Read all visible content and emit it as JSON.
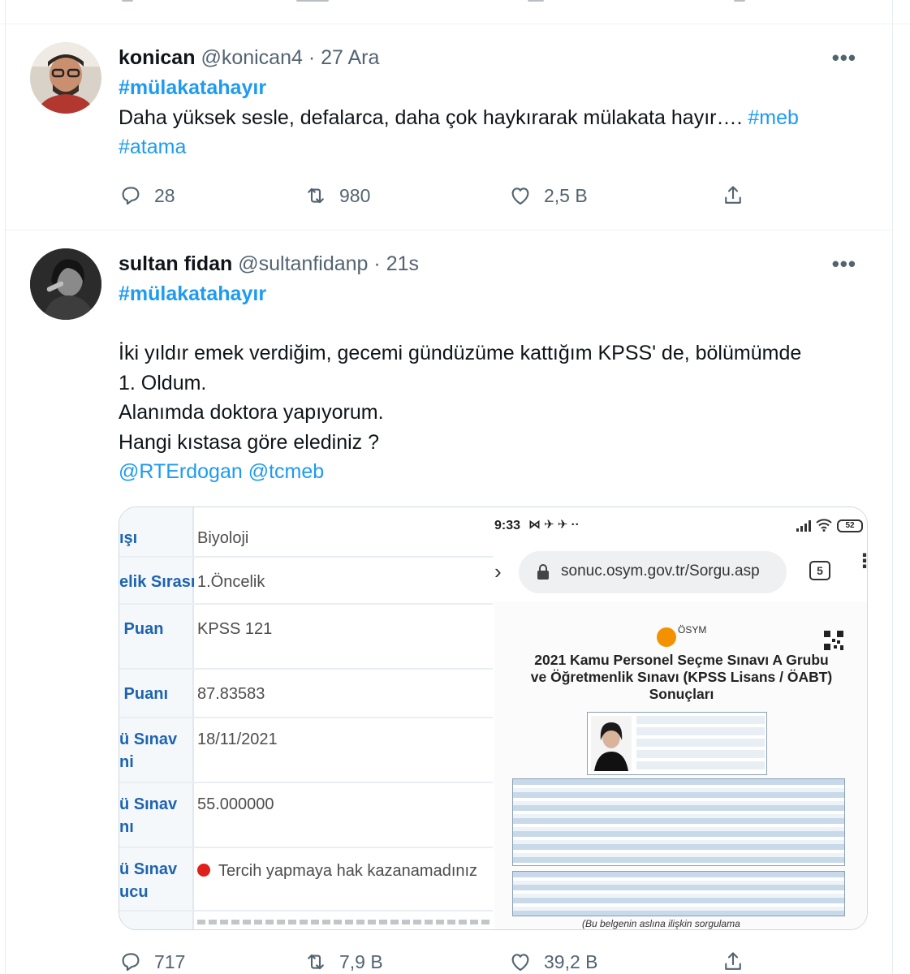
{
  "tweets": [
    {
      "name": "konican",
      "handle": "@konican4",
      "time": "27 Ara",
      "more": "•••",
      "hashtag": "#mülakatahayır",
      "text_line1": "Daha yüksek sesle, defalarca, daha çok haykırarak mülakata hayır…. ",
      "tag1": "#meb",
      "tag2": "#atama",
      "replies": "28",
      "retweets": "980",
      "likes": "2,5 B"
    },
    {
      "name": "sultan fidan",
      "handle": "@sultanfidanp",
      "time": "21s",
      "more": "•••",
      "hashtag": "#mülakatahayır",
      "line1": "İki yıldır emek verdiğim, gecemi gündüzüme kattığım KPSS' de, bölümümde",
      "line2": "1. Oldum.",
      "line3": "Alanımda doktora yapıyorum.",
      "line4": "Hangi kıstasa göre elediniz ?",
      "mention1": "@RTErdogan",
      "mention2": "@tcmeb",
      "replies": "717",
      "retweets": "7,9 B",
      "likes": "39,2 B"
    }
  ],
  "media": {
    "left_rows": [
      {
        "label": "ışı",
        "value": "Biyoloji"
      },
      {
        "label": "elik Sırası",
        "value": "1.Öncelik"
      },
      {
        "label": " Puan\n",
        "value": "KPSS 121"
      },
      {
        "label": " Puanı",
        "value": "87.83583"
      },
      {
        "label": "ü Sınav\nni",
        "value": "18/11/2021"
      },
      {
        "label": "ü Sınav\nnı",
        "value": "55.000000"
      },
      {
        "label": "ü Sınav\nucu",
        "value": "Tercih yapmaya hak kazanamadınız"
      }
    ],
    "phone": {
      "time": "9:33",
      "url": "sonuc.osym.gov.tr/Sorgu.asp",
      "tabs": "5",
      "battery": "52",
      "logo_text": "ÖSYM",
      "title_line1": "2021 Kamu Personel Seçme Sınavı A Grubu",
      "title_line2": "ve Öğretmenlik Sınavı (KPSS Lisans / ÖABT)",
      "title_line3": "Sonuçları",
      "footer_note": "(Bu belgenin aslına ilişkin sorgulama"
    }
  },
  "colors": {
    "link": "#1d9bf0",
    "muted": "#536471",
    "text": "#0f1419"
  }
}
